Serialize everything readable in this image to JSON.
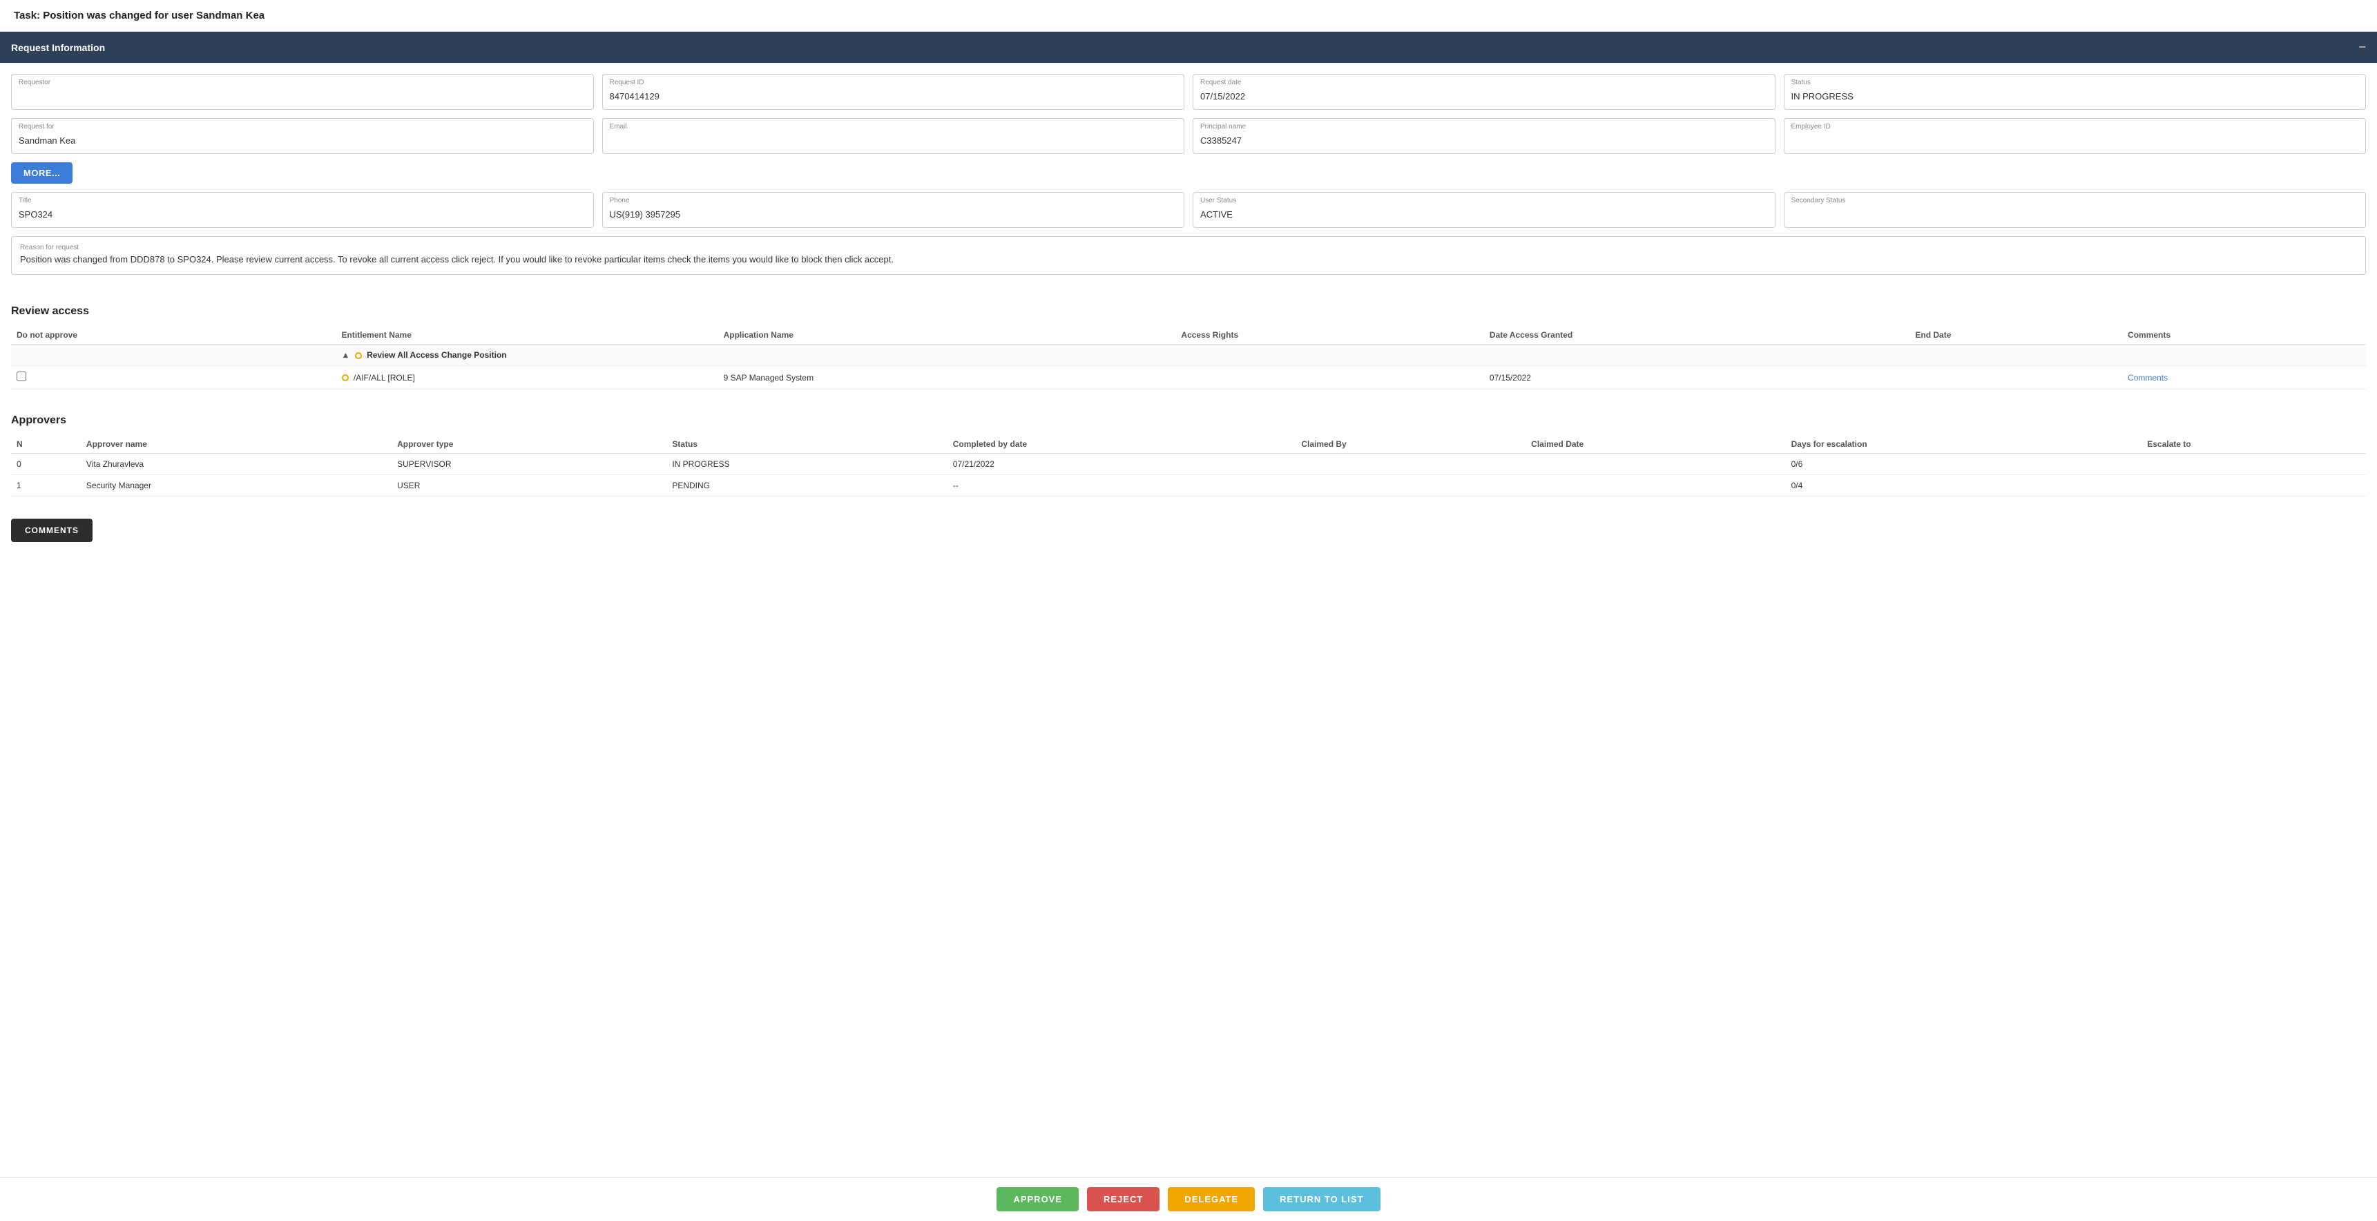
{
  "page": {
    "title": "Task: Position was changed for user Sandman Kea"
  },
  "request_info": {
    "header": "Request Information",
    "fields": {
      "requestor_label": "Requestor",
      "requestor_value": "",
      "request_id_label": "Request ID",
      "request_id_value": "8470414129",
      "request_date_label": "Request date",
      "request_date_value": "07/15/2022",
      "status_label": "Status",
      "status_value": "IN PROGRESS",
      "request_for_label": "Request for",
      "request_for_value": "Sandman Kea",
      "email_label": "Email",
      "email_value": "",
      "principal_name_label": "Principal name",
      "principal_name_value": "C3385247",
      "employee_id_label": "Employee ID",
      "employee_id_value": "",
      "title_label": "Title",
      "title_value": "SPO324",
      "phone_label": "Phone",
      "phone_value": "US(919) 3957295",
      "user_status_label": "User Status",
      "user_status_value": "ACTIVE",
      "secondary_status_label": "Secondary Status",
      "secondary_status_value": "",
      "more_button": "MORE...",
      "reason_label": "Reason for request",
      "reason_value": "Position was changed from DDD878 to SPO324. Please review current access. To revoke all current access click reject. If you would like to revoke particular items check the items you would like to block then click accept."
    }
  },
  "review_access": {
    "title": "Review access",
    "columns": {
      "do_not_approve": "Do not approve",
      "entitlement_name": "Entitlement Name",
      "application_name": "Application Name",
      "access_rights": "Access Rights",
      "date_access_granted": "Date Access Granted",
      "end_date": "End Date",
      "comments": "Comments"
    },
    "group": {
      "name": "Review All Access Change Position"
    },
    "rows": [
      {
        "entitlement": "/AIF/ALL [ROLE]",
        "application": "9 SAP Managed System",
        "access_rights": "",
        "date_granted": "07/15/2022",
        "end_date": "",
        "comments_link": "Comments"
      }
    ]
  },
  "approvers": {
    "title": "Approvers",
    "columns": {
      "n": "N",
      "approver_name": "Approver name",
      "approver_type": "Approver type",
      "status": "Status",
      "completed_by_date": "Completed by date",
      "claimed_by": "Claimed By",
      "claimed_date": "Claimed Date",
      "days_escalation": "Days for escalation",
      "escalate_to": "Escalate to"
    },
    "rows": [
      {
        "n": "0",
        "approver_name": "Vita Zhuravleva",
        "approver_type": "SUPERVISOR",
        "status": "IN PROGRESS",
        "completed_by_date": "07/21/2022",
        "claimed_by": "",
        "claimed_date": "",
        "days_escalation": "0/6",
        "escalate_to": ""
      },
      {
        "n": "1",
        "approver_name": "Security Manager",
        "approver_type": "USER",
        "status": "PENDING",
        "completed_by_date": "--",
        "claimed_by": "",
        "claimed_date": "",
        "days_escalation": "0/4",
        "escalate_to": ""
      }
    ]
  },
  "buttons": {
    "comments": "COMMENTS",
    "approve": "APPROVE",
    "reject": "REJECT",
    "delegate": "DELEGATE",
    "return_to_list": "RETURN TO LIST"
  }
}
